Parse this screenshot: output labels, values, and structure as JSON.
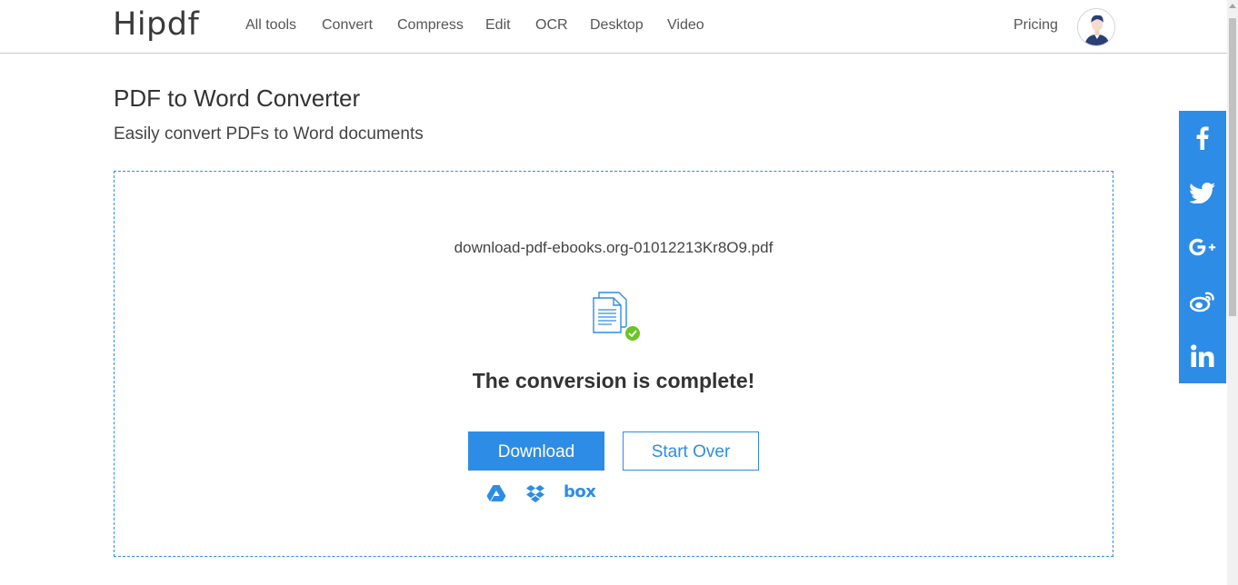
{
  "header": {
    "logo": "Hipdf",
    "nav": [
      {
        "label": "All tools"
      },
      {
        "label": "Convert"
      },
      {
        "label": "Compress"
      },
      {
        "label": "Edit"
      },
      {
        "label": "OCR"
      },
      {
        "label": "Desktop"
      },
      {
        "label": "Video"
      }
    ],
    "pricing": "Pricing",
    "avatar_icon": "user-avatar-icon"
  },
  "page": {
    "title": "PDF to Word Converter",
    "subtitle": "Easily convert PDFs to Word documents"
  },
  "result": {
    "filename": "download-pdf-ebooks.org-01012213Kr8O9.pdf",
    "status_icon": "document-check-icon",
    "message": "The conversion is complete!",
    "download_label": "Download",
    "start_over_label": "Start Over",
    "cloud_targets": [
      {
        "name": "google-drive",
        "icon": "google-drive-icon"
      },
      {
        "name": "dropbox",
        "icon": "dropbox-icon"
      },
      {
        "name": "box",
        "icon": "box-icon",
        "text": "box"
      }
    ]
  },
  "social": [
    {
      "name": "facebook",
      "icon": "facebook-icon"
    },
    {
      "name": "twitter",
      "icon": "twitter-icon"
    },
    {
      "name": "google-plus",
      "icon": "google-plus-icon"
    },
    {
      "name": "weibo",
      "icon": "weibo-icon"
    },
    {
      "name": "linkedin",
      "icon": "linkedin-icon"
    }
  ],
  "colors": {
    "accent": "#2d8ce6",
    "success": "#6cc424",
    "text": "#333333",
    "nav_text": "#555555"
  }
}
